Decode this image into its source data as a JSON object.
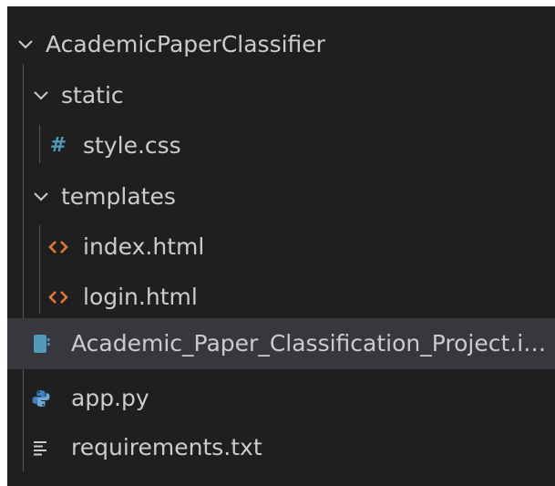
{
  "explorer": {
    "root": {
      "label": "AcademicPaperClassifier",
      "expanded": true
    },
    "items": [
      {
        "label": "static",
        "type": "folder",
        "depth": 1,
        "expanded": true
      },
      {
        "label": "style.css",
        "type": "file",
        "depth": 2,
        "icon": "hash-icon"
      },
      {
        "label": "templates",
        "type": "folder",
        "depth": 1,
        "expanded": true
      },
      {
        "label": "index.html",
        "type": "file",
        "depth": 2,
        "icon": "html-brackets-icon"
      },
      {
        "label": "login.html",
        "type": "file",
        "depth": 2,
        "icon": "html-brackets-icon"
      },
      {
        "label": "Academic_Paper_Classification_Project.ipynb",
        "type": "file",
        "depth": 1,
        "icon": "notebook-icon",
        "selected": true
      },
      {
        "label": "app.py",
        "type": "file",
        "depth": 1,
        "icon": "python-icon"
      },
      {
        "label": "requirements.txt",
        "type": "file",
        "depth": 1,
        "icon": "text-lines-icon"
      }
    ]
  },
  "colors": {
    "background": "#1f1f1f",
    "text": "#cccccc",
    "selection": "#37373d",
    "css_icon": "#519aba",
    "html_icon": "#e37933",
    "notebook_icon": "#519aba",
    "python_icon": "#3d7fbf"
  }
}
